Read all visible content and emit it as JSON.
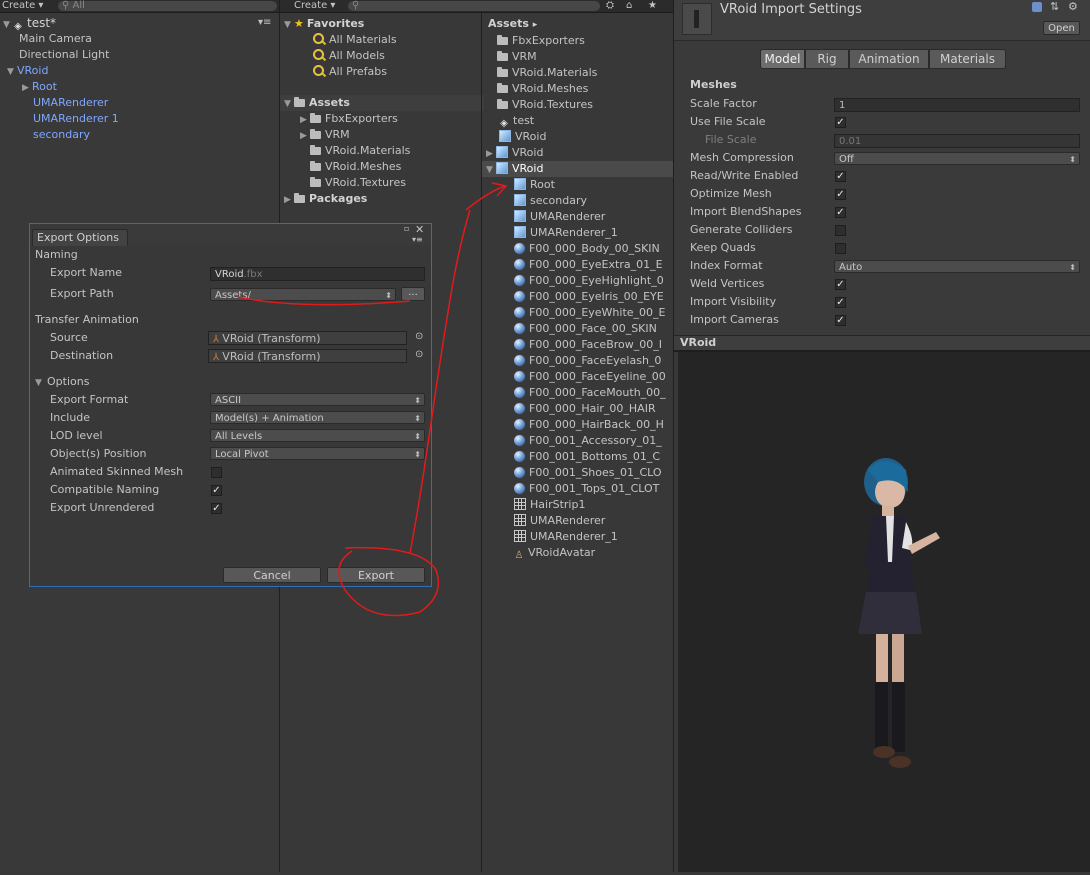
{
  "hierarchy": {
    "create_label": "Create",
    "search_text": "All",
    "scene_name": "test*",
    "items": [
      {
        "label": "Main Camera"
      },
      {
        "label": "Directional Light"
      },
      {
        "label": "VRoid"
      },
      {
        "label": "Root"
      },
      {
        "label": "UMARenderer"
      },
      {
        "label": "UMARenderer 1"
      },
      {
        "label": "secondary"
      }
    ]
  },
  "project": {
    "create_label": "Create",
    "favorites_label": "Favorites",
    "favorites": [
      "All Materials",
      "All Models",
      "All Prefabs"
    ],
    "assets_label": "Assets",
    "asset_folders": [
      "FbxExporters",
      "VRM",
      "VRoid.Materials",
      "VRoid.Meshes",
      "VRoid.Textures"
    ],
    "packages_label": "Packages",
    "breadcrumb": "Assets",
    "breadcrumb_arrow": "▸",
    "files": [
      {
        "label": "FbxExporters",
        "icon": "folder-icon"
      },
      {
        "label": "VRM",
        "icon": "folder-icon"
      },
      {
        "label": "VRoid.Materials",
        "icon": "folder-icon"
      },
      {
        "label": "VRoid.Meshes",
        "icon": "folder-icon"
      },
      {
        "label": "VRoid.Textures",
        "icon": "folder-icon"
      },
      {
        "label": "test",
        "icon": "unity-scene-icon"
      },
      {
        "label": "VRoid",
        "icon": "prefab-icon"
      },
      {
        "label": "VRoid",
        "icon": "model-icon"
      },
      {
        "label": "VRoid",
        "icon": "model-icon"
      }
    ],
    "children": [
      {
        "label": "Root",
        "icon": "mesh-cube-icon"
      },
      {
        "label": "secondary",
        "icon": "mesh-cube-icon"
      },
      {
        "label": "UMARenderer",
        "icon": "mesh-cube-icon"
      },
      {
        "label": "UMARenderer_1",
        "icon": "mesh-cube-icon"
      },
      {
        "label": "F00_000_Body_00_SKIN",
        "icon": "material-sphere-icon"
      },
      {
        "label": "F00_000_EyeExtra_01_E",
        "icon": "material-sphere-icon"
      },
      {
        "label": "F00_000_EyeHighlight_0",
        "icon": "material-sphere-icon"
      },
      {
        "label": "F00_000_EyeIris_00_EYE",
        "icon": "material-sphere-icon"
      },
      {
        "label": "F00_000_EyeWhite_00_E",
        "icon": "material-sphere-icon"
      },
      {
        "label": "F00_000_Face_00_SKIN",
        "icon": "material-sphere-icon"
      },
      {
        "label": "F00_000_FaceBrow_00_I",
        "icon": "material-sphere-icon"
      },
      {
        "label": "F00_000_FaceEyelash_0",
        "icon": "material-sphere-icon"
      },
      {
        "label": "F00_000_FaceEyeline_00",
        "icon": "material-sphere-icon"
      },
      {
        "label": "F00_000_FaceMouth_00_",
        "icon": "material-sphere-icon"
      },
      {
        "label": "F00_000_Hair_00_HAIR",
        "icon": "material-sphere-icon"
      },
      {
        "label": "F00_000_HairBack_00_H",
        "icon": "material-sphere-icon"
      },
      {
        "label": "F00_001_Accessory_01_",
        "icon": "material-sphere-icon"
      },
      {
        "label": "F00_001_Bottoms_01_C",
        "icon": "material-sphere-icon"
      },
      {
        "label": "F00_001_Shoes_01_CLO",
        "icon": "material-sphere-icon"
      },
      {
        "label": "F00_001_Tops_01_CLOT",
        "icon": "material-sphere-icon"
      },
      {
        "label": "HairStrip1",
        "icon": "mesh-grid-icon"
      },
      {
        "label": "UMARenderer",
        "icon": "mesh-grid-icon"
      },
      {
        "label": "UMARenderer_1",
        "icon": "mesh-grid-icon"
      },
      {
        "label": "VRoidAvatar",
        "icon": "avatar-icon"
      }
    ]
  },
  "export_dialog": {
    "title": "Export Options",
    "naming_label": "Naming",
    "export_name_label": "Export Name",
    "export_name_value": "VRoid",
    "export_name_ext": ".fbx",
    "export_path_label": "Export Path",
    "export_path_value": "Assets/",
    "browse_label": "...",
    "transfer_label": "Transfer Animation",
    "source_label": "Source",
    "source_value": "VRoid (Transform)",
    "destination_label": "Destination",
    "destination_value": "VRoid (Transform)",
    "options_label": "Options",
    "export_format_label": "Export Format",
    "export_format_value": "ASCII",
    "include_label": "Include",
    "include_value": "Model(s) + Animation",
    "lod_label": "LOD level",
    "lod_value": "All Levels",
    "position_label": "Object(s) Position",
    "position_value": "Local Pivot",
    "animated_label": "Animated Skinned Mesh",
    "animated_checked": false,
    "compatible_label": "Compatible Naming",
    "compatible_checked": true,
    "unrendered_label": "Export Unrendered",
    "unrendered_checked": true,
    "cancel_label": "Cancel",
    "export_label": "Export"
  },
  "inspector": {
    "title": "VRoid Import Settings",
    "open_label": "Open",
    "tabs": [
      "Model",
      "Rig",
      "Animation",
      "Materials"
    ],
    "active_tab": "Model",
    "section_label": "Meshes",
    "settings": [
      {
        "label": "Scale Factor",
        "type": "text",
        "value": "1"
      },
      {
        "label": "Use File Scale",
        "type": "check",
        "checked": true
      },
      {
        "label": "File Scale",
        "type": "text-disabled",
        "value": "0.01"
      },
      {
        "label": "Mesh Compression",
        "type": "popup",
        "value": "Off"
      },
      {
        "label": "Read/Write Enabled",
        "type": "check",
        "checked": true
      },
      {
        "label": "Optimize Mesh",
        "type": "check",
        "checked": true
      },
      {
        "label": "Import BlendShapes",
        "type": "check",
        "checked": true
      },
      {
        "label": "Generate Colliders",
        "type": "check",
        "checked": false
      },
      {
        "label": "Keep Quads",
        "type": "check",
        "checked": false
      },
      {
        "label": "Index Format",
        "type": "popup",
        "value": "Auto"
      },
      {
        "label": "Weld Vertices",
        "type": "check",
        "checked": true
      },
      {
        "label": "Import Visibility",
        "type": "check",
        "checked": true
      },
      {
        "label": "Import Cameras",
        "type": "check",
        "checked": true
      }
    ],
    "preview_label": "VRoid"
  },
  "colors": {
    "background": "#383838",
    "selection_blue": "#7fa7ff",
    "dialog_border": "#2f6fb5",
    "annotation_red": "#e01b1b",
    "preview_bg": "#252525"
  }
}
